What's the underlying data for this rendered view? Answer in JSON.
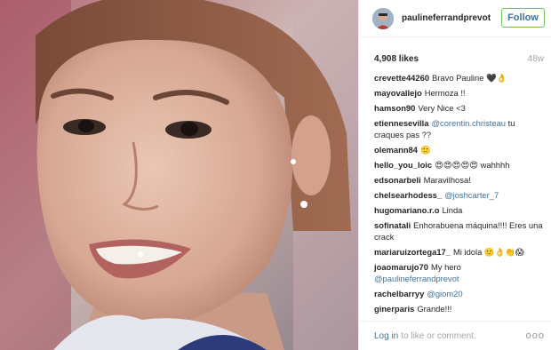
{
  "post": {
    "author": "paulineferrandprevot",
    "follow_label": "Follow",
    "likes": "4,908 likes",
    "age": "48w",
    "comments": [
      {
        "user": "crevette44260",
        "text": "Bravo Pauline 🖤👌"
      },
      {
        "user": "mayovallejo",
        "text": "Hermoza !!"
      },
      {
        "user": "hamson90",
        "text": "Very Nice <3"
      },
      {
        "user": "etiennesevilla",
        "mention": "@corentin.christeau",
        "text": " tu craques pas ??"
      },
      {
        "user": "olemann84",
        "text": "🙂"
      },
      {
        "user": "hello_you_loic",
        "text": "😍😍😍😍😍 wahhhh"
      },
      {
        "user": "edsonarbeli",
        "text": "Maravilhosa!"
      },
      {
        "user": "chelsearhodess_",
        "mention": "@joshcarter_7",
        "text": ""
      },
      {
        "user": "hugomariano.r.o",
        "text": "Linda"
      },
      {
        "user": "sofinatali",
        "text": "Enhorabuena máquina!!!! Eres una crack"
      },
      {
        "user": "mariaruizortega17_",
        "text": "Mi idola 🙂👌👏😱"
      },
      {
        "user": "joaomarujo70",
        "text": "My hero",
        "mention_after": "@paulineferrandprevot"
      },
      {
        "user": "rachelbarryy",
        "mention": "@giom20",
        "text": ""
      },
      {
        "user": "ginerparis",
        "text": "Grande!!!"
      }
    ],
    "footer": {
      "login_label": "Log in",
      "login_rest": "to like or comment.",
      "more_label": "ooo"
    }
  },
  "colors": {
    "link": "#3f729b",
    "follow_border": "#70c050",
    "muted": "#a5a7aa",
    "text": "#262626"
  },
  "icons": {
    "avatar": "profile-photo",
    "more": "more-options-icon"
  }
}
